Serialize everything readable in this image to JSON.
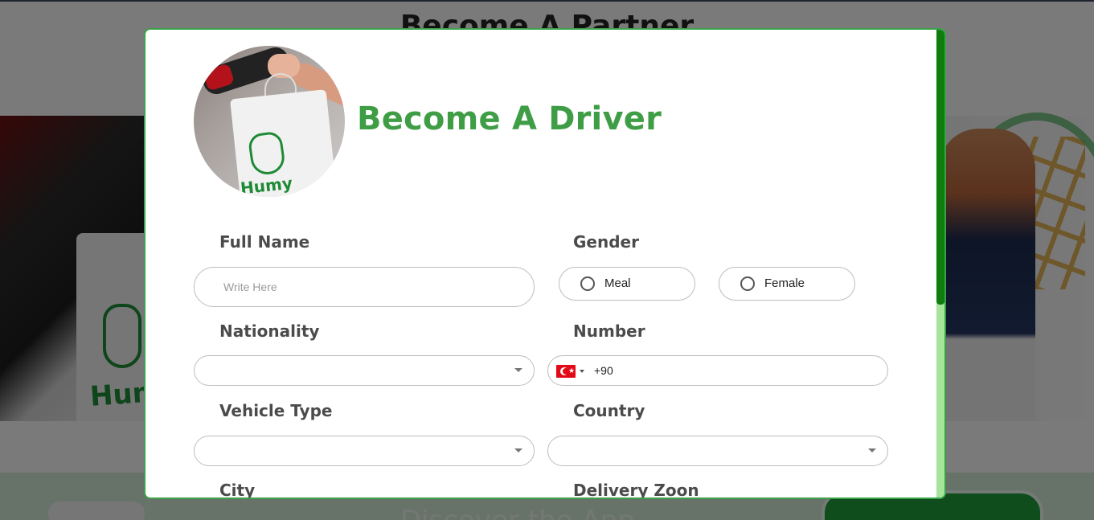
{
  "background": {
    "heading": "Become A Partner",
    "bag_logo": "Humy",
    "app_banner_text": "Discover the App"
  },
  "modal": {
    "title": "Become A Driver",
    "avatar_logo": "Humy",
    "full_name": {
      "label": "Full Name",
      "placeholder": "Write Here",
      "value": ""
    },
    "gender": {
      "label": "Gender",
      "options": [
        {
          "label": "Meal",
          "checked": false
        },
        {
          "label": "Female",
          "checked": false
        }
      ]
    },
    "nationality": {
      "label": "Nationality",
      "value": ""
    },
    "number": {
      "label": "Number",
      "country_flag": "turkey-flag-icon",
      "dial_code": "+90",
      "value": ""
    },
    "vehicle_type": {
      "label": "Vehicle Type",
      "value": ""
    },
    "country": {
      "label": "Country",
      "value": ""
    },
    "city": {
      "label": "City"
    },
    "delivery_zone": {
      "label": "Delivery Zoon"
    }
  },
  "colors": {
    "accent_green": "#3f9e45",
    "modal_border": "#3aa34a",
    "scrollbar_thumb": "#0e7d0e",
    "scrollbar_track": "#a6e39b",
    "label_text": "#4b4b4b"
  }
}
